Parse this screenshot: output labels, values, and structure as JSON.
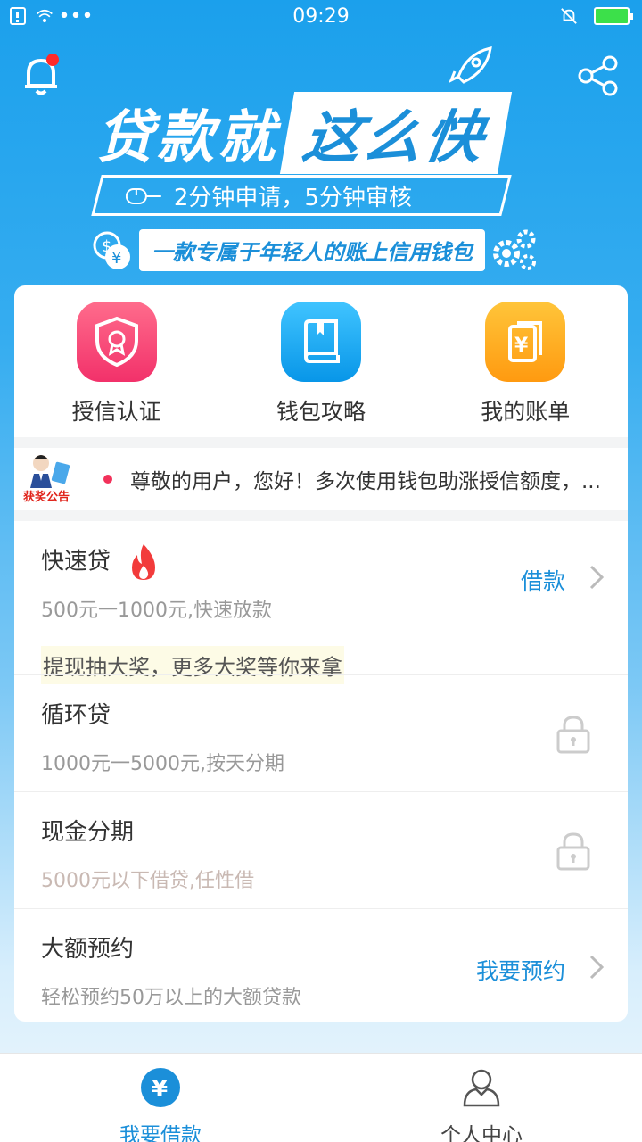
{
  "status_bar": {
    "time": "09:29"
  },
  "header": {
    "title_left": "贷款就",
    "title_right": "这么快",
    "subtitle": "2分钟申请，5分钟审核",
    "tagline": "一款专属于年轻人的账上信用钱包"
  },
  "quick_actions": [
    {
      "label": "授信认证",
      "icon": "shield-badge-icon"
    },
    {
      "label": "钱包攻略",
      "icon": "book-icon"
    },
    {
      "label": "我的账单",
      "icon": "bill-icon"
    }
  ],
  "notice": {
    "badge_text": "获奖公告",
    "text": "尊敬的用户，您好！多次使用钱包助涨授信额度，..."
  },
  "loans": [
    {
      "title": "快速贷",
      "desc": "500元一1000元,快速放款",
      "action": "借款",
      "promo": "提现抽大奖，更多大奖等你来拿"
    },
    {
      "title": "循环贷",
      "desc": "1000元一5000元,按天分期"
    },
    {
      "title": "现金分期",
      "desc": "5000元以下借贷,任性借"
    },
    {
      "title": "大额预约",
      "desc": "轻松预约50万以上的大额贷款",
      "action": "我要预约"
    }
  ],
  "bottom_nav": [
    {
      "label": "我要借款",
      "active": true
    },
    {
      "label": "个人中心",
      "active": false
    }
  ],
  "colors": {
    "primary": "#1b8fd9",
    "brand_blue": "#1ba0ec"
  }
}
